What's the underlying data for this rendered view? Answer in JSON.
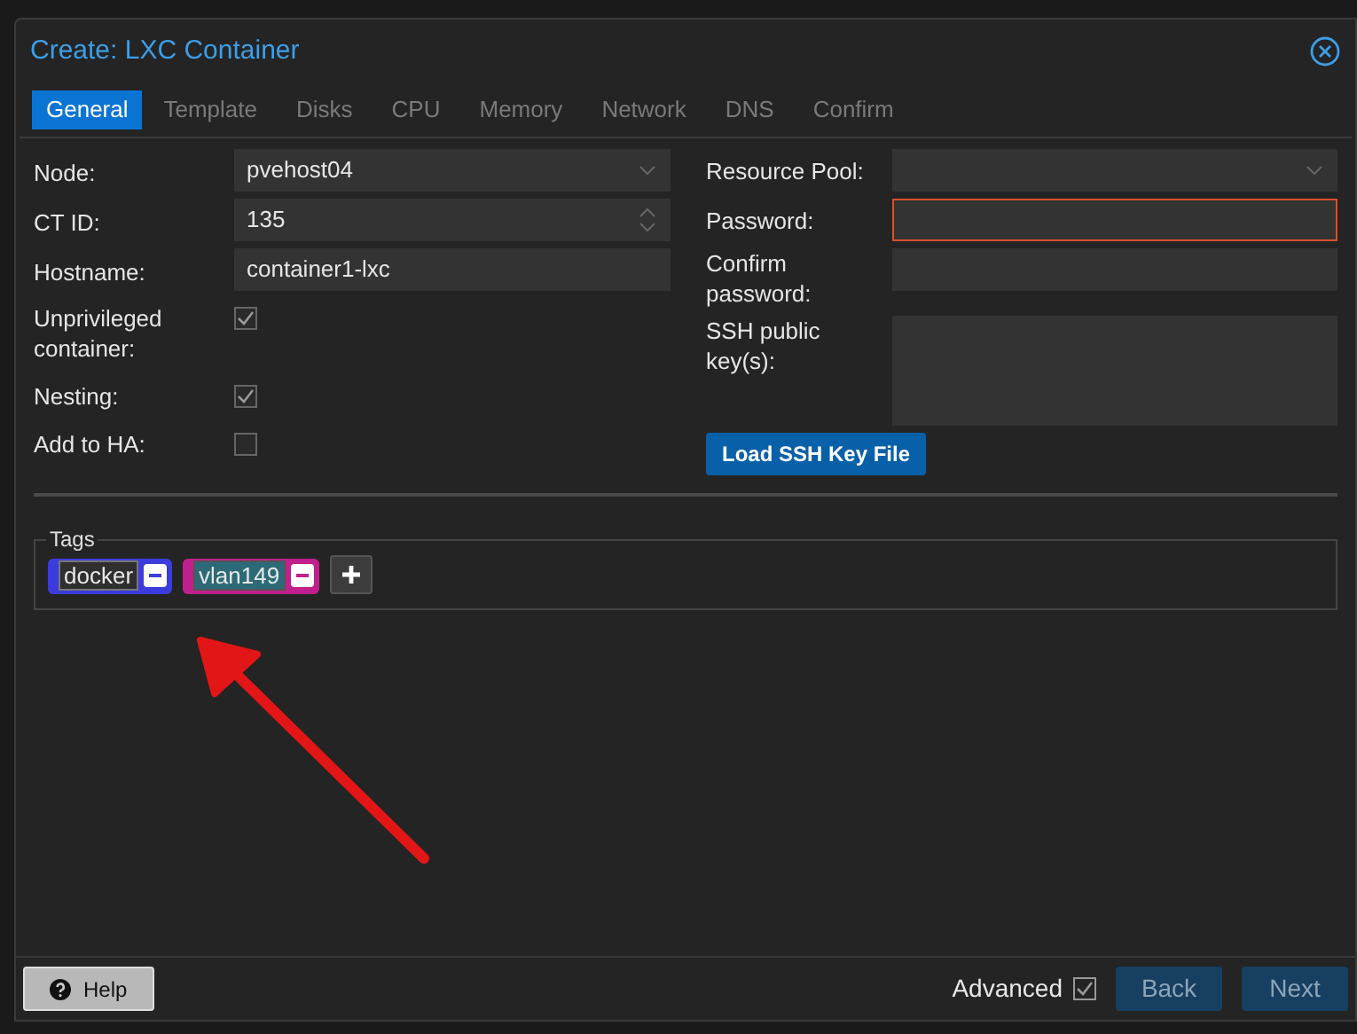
{
  "dialog": {
    "title": "Create: LXC Container"
  },
  "tabs": [
    {
      "label": "General",
      "selected": true
    },
    {
      "label": "Template",
      "selected": false
    },
    {
      "label": "Disks",
      "selected": false
    },
    {
      "label": "CPU",
      "selected": false
    },
    {
      "label": "Memory",
      "selected": false
    },
    {
      "label": "Network",
      "selected": false
    },
    {
      "label": "DNS",
      "selected": false
    },
    {
      "label": "Confirm",
      "selected": false
    }
  ],
  "left_fields": [
    {
      "kind": "combo",
      "label": "Node:",
      "value": "pvehost04"
    },
    {
      "kind": "spinner",
      "label": "CT ID:",
      "value": "135"
    },
    {
      "kind": "text",
      "label": "Hostname:",
      "value": "container1-lxc"
    },
    {
      "kind": "checkbox",
      "label": "Unprivileged container:",
      "checked": true
    },
    {
      "kind": "checkbox",
      "label": "Nesting:",
      "checked": true
    },
    {
      "kind": "checkbox",
      "label": "Add to HA:",
      "checked": false
    }
  ],
  "right_fields": [
    {
      "kind": "combo",
      "label": "Resource Pool:",
      "invalid": false
    },
    {
      "kind": "text",
      "label": "Password:",
      "invalid": true
    },
    {
      "kind": "text",
      "label": "Confirm password:",
      "invalid": false
    },
    {
      "kind": "textarea",
      "label": "SSH public key(s):",
      "invalid": false
    }
  ],
  "load_key_button": "Load SSH Key File",
  "tags": {
    "legend": "Tags",
    "items": [
      {
        "label": "docker",
        "color": "#3c3cdc"
      },
      {
        "label": "vlan149",
        "color": "#c0208e"
      }
    ]
  },
  "footer": {
    "help": "Help",
    "advanced": {
      "label": "Advanced",
      "checked": true
    },
    "back": "Back",
    "next": "Next"
  }
}
